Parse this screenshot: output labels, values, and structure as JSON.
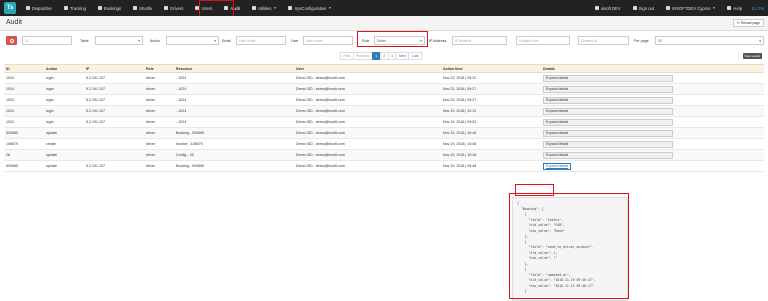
{
  "nav": {
    "logo": "Ts",
    "items": [
      {
        "label": "Dispatcher",
        "icon": "monitor-icon"
      },
      {
        "label": "Tracking",
        "icon": "map-pin-icon"
      },
      {
        "label": "Bookings",
        "icon": "book-icon"
      },
      {
        "label": "Shuttle",
        "icon": "bus-icon"
      },
      {
        "label": "Drivers",
        "icon": "user-icon"
      },
      {
        "label": "Users",
        "icon": "users-icon"
      },
      {
        "label": "Audit",
        "icon": "audit-icon"
      },
      {
        "label": "Utilities",
        "icon": "wrench-icon"
      },
      {
        "label": "SysConfiguration",
        "icon": "gear-icon"
      }
    ],
    "right": [
      {
        "label": "insoft DEV",
        "icon": "user-icon"
      },
      {
        "label": "Sign out",
        "icon": "signout-icon"
      },
      {
        "label": "INSOFTDEV Cyprus",
        "icon": "building-icon"
      },
      {
        "label": "Help",
        "icon": "help-icon"
      }
    ],
    "lang": "EL EN"
  },
  "page": {
    "title": "Audit",
    "reload_label": "Reload page"
  },
  "filters": {
    "id_placeholder": "ID",
    "table_label": "Table",
    "action_label": "Action",
    "email_label": "Email",
    "email_placeholder": "User email",
    "user_label": "User",
    "user_placeholder": "User name",
    "role_label": "Role",
    "role_value": "Driver",
    "ip_label": "IP Address",
    "ip_placeholder": "IP Address",
    "created_from_placeholder": "Created from",
    "created_to_placeholder": "Created to",
    "perpage_label": "Per page",
    "perpage_value": "20"
  },
  "pagination": {
    "first": "First",
    "previous": "Previous",
    "pages": [
      "1",
      "2",
      "3"
    ],
    "next": "Next",
    "last": "Last"
  },
  "hide_results": "hide results",
  "table": {
    "headers": [
      "ID",
      "Action",
      "IP",
      "Role",
      "Resource",
      "User",
      "Action time",
      "Details"
    ],
    "rows": [
      {
        "id": "1024",
        "action": "login",
        "ip": "5.2.191.107",
        "role": "driver",
        "resource": "- 1024",
        "user": "Demo ISD - demo@insoft.com",
        "time": "Nov 22, 2018 | 09:22",
        "details": "Expand details"
      },
      {
        "id": "1024",
        "action": "login",
        "ip": "5.2.191.107",
        "role": "driver",
        "resource": "- 1024",
        "user": "Demo ISD - demo@insoft.com",
        "time": "Nov 22, 2018 | 09:27",
        "details": "Expand details"
      },
      {
        "id": "1024",
        "action": "login",
        "ip": "5.2.191.107",
        "role": "driver",
        "resource": "- 1024",
        "user": "Demo ISD - demo@insoft.com",
        "time": "Nov 22, 2018 | 09:27",
        "details": "Expand details"
      },
      {
        "id": "1024",
        "action": "login",
        "ip": "5.2.191.107",
        "role": "driver",
        "resource": "- 1024",
        "user": "Demo ISD - demo@insoft.com",
        "time": "Nov 19, 2018 | 10:12",
        "details": "Expand details"
      },
      {
        "id": "1024",
        "action": "login",
        "ip": "5.2.191.107",
        "role": "driver",
        "resource": "- 1024",
        "user": "Demo ISD - demo@insoft.com",
        "time": "Nov 19, 2018 | 09:53",
        "details": "Expand details"
      },
      {
        "id": "593665",
        "action": "update",
        "ip": "",
        "role": "driver",
        "resource": "Booking - 593665",
        "user": "Demo ISD - demo@insoft.com",
        "time": "Nov 19, 2018 | 10:46",
        "details": "Expand details"
      },
      {
        "id": "106679",
        "action": "create",
        "ip": "",
        "role": "driver",
        "resource": "Invoice - 106679",
        "user": "Demo ISD - demo@insoft.com",
        "time": "Nov 19, 2018 | 10:46",
        "details": "Expand details"
      },
      {
        "id": "26",
        "action": "update",
        "ip": "",
        "role": "driver",
        "resource": "Config - 26",
        "user": "Demo ISD - demo@insoft.com",
        "time": "Nov 19, 2018 | 10:46",
        "details": "Expand details"
      },
      {
        "id": "593665",
        "action": "update",
        "ip": "5.2.191.107",
        "role": "driver",
        "resource": "Booking - 593665",
        "user": "Demo ISD - demo@insoft.com",
        "time": "Nov 19, 2018 | 09:48",
        "details": "Expand details"
      }
    ]
  },
  "json_detail": [
    "{",
    "  \"Booking\": [",
    "    {",
    "      \"field\": \"status\",",
    "      \"old_value\": \"FOB\",",
    "      \"new_value\": \"Done\"",
    "    },",
    "    {",
    "      \"field\": \"send_to_driver_account\",",
    "      \"old_value\": 1,",
    "      \"new_value\": \"\"",
    "    },",
    "    {",
    "      \"field\": \"updated_at\",",
    "      \"old_value\": \"2018-11-19 09:46:37\",",
    "      \"new_value\": \"2018-11-19 09:48:17\"",
    "    }"
  ]
}
